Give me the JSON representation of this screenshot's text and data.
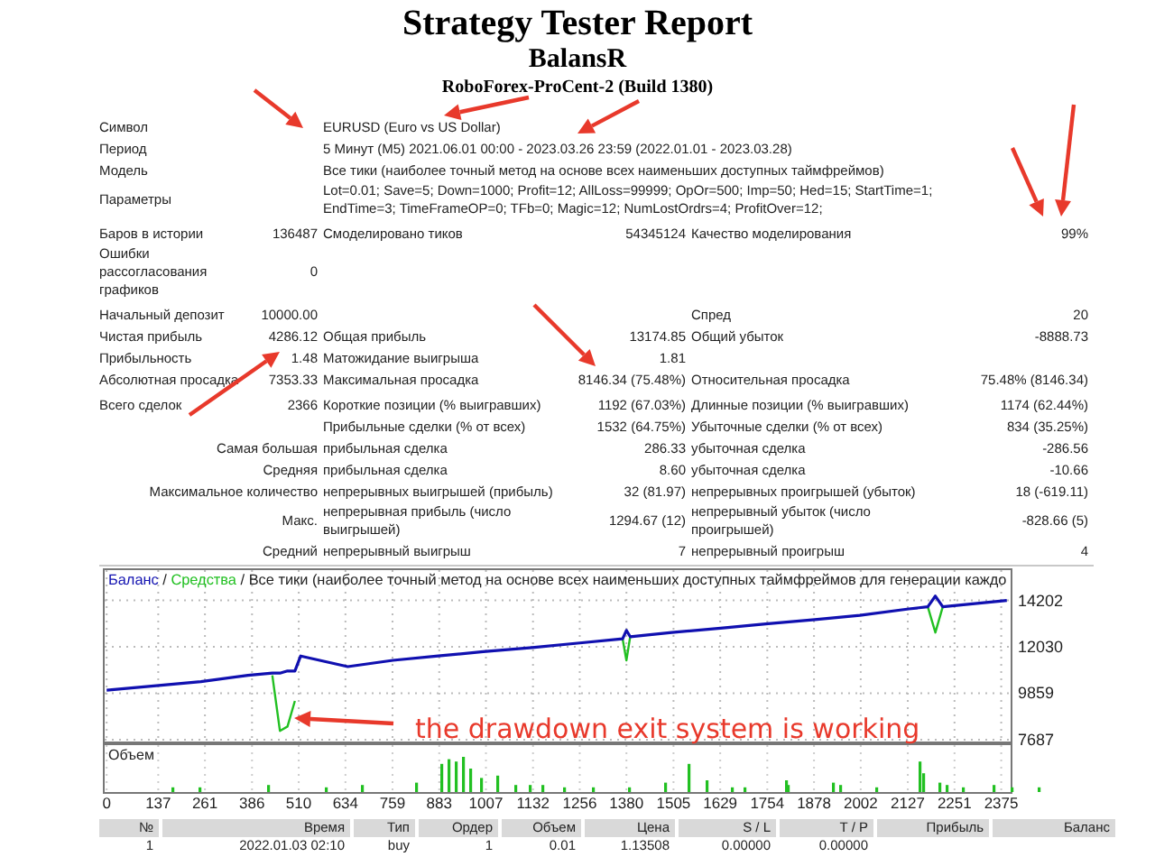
{
  "report": {
    "title": "Strategy Tester Report",
    "expert": "BalansR",
    "server": "RoboForex-ProCent-2 (Build 1380)"
  },
  "summary": {
    "sections": [
      {
        "rows": [
          {
            "kind": "wide",
            "cells": [
              "Символ",
              "EURUSD (Euro vs US Dollar)"
            ]
          },
          {
            "kind": "wide",
            "cells": [
              "Период",
              "5 Минут (M5) 2021.06.01 00:00 - 2023.03.26 23:59 (2022.01.01 - 2023.03.28)"
            ]
          },
          {
            "kind": "wide",
            "cells": [
              "Модель",
              "Все тики (наиболее точный метод на основе всех наименьших доступных таймфреймов)"
            ]
          },
          {
            "kind": "wide",
            "cells": [
              "Параметры",
              "Lot=0.01; Save=5; Down=1000; Profit=12; AllLoss=99999; OpOr=500; Imp=50; Hed=15; StartTime=1; EndTime=3; TimeFrameOP=0; TFb=0; Magic=12; NumLostOrdrs=4; ProfitOver=12;"
            ]
          }
        ]
      },
      {
        "rows": [
          {
            "kind": "grid",
            "cells": [
              "Баров в истории",
              "136487",
              "Смоделировано тиков",
              "54345124",
              "Качество моделирования",
              "99%"
            ]
          },
          {
            "kind": "grid",
            "cells": [
              "Ошибки рассогласования графиков",
              "0",
              "",
              "",
              "",
              ""
            ]
          }
        ]
      },
      {
        "rows": [
          {
            "kind": "grid",
            "cells": [
              "Начальный депозит",
              "10000.00",
              "",
              "",
              "Спред",
              "20"
            ]
          },
          {
            "kind": "grid",
            "cells": [
              "Чистая прибыль",
              "4286.12",
              "Общая прибыль",
              "13174.85",
              "Общий убыток",
              "-8888.73"
            ]
          },
          {
            "kind": "grid",
            "cells": [
              "Прибыльность",
              "1.48",
              "Матожидание выигрыша",
              "1.81",
              "",
              ""
            ]
          },
          {
            "kind": "grid",
            "cells": [
              "Абсолютная просадка",
              "7353.33",
              "Максимальная просадка",
              "8146.34 (75.48%)",
              "Относительная просадка",
              "75.48% (8146.34)"
            ]
          }
        ]
      },
      {
        "rows": [
          {
            "kind": "grid",
            "cells": [
              "Всего сделок",
              "2366",
              "Короткие позиции (% выигравших)",
              "1192 (67.03%)",
              "Длинные позиции (% выигравших)",
              "1174 (62.44%)"
            ]
          },
          {
            "kind": "grid",
            "cells": [
              "",
              "",
              "Прибыльные сделки (% от всех)",
              "1532 (64.75%)",
              "Убыточные сделки (% от всех)",
              "834 (35.25%)"
            ]
          },
          {
            "kind": "group",
            "cells": [
              "",
              "Самая большая",
              "прибыльная сделка",
              "286.33",
              "убыточная сделка",
              "-286.56"
            ]
          },
          {
            "kind": "group",
            "cells": [
              "",
              "Средняя",
              "прибыльная сделка",
              "8.60",
              "убыточная сделка",
              "-10.66"
            ]
          },
          {
            "kind": "group",
            "cells": [
              "",
              "Максимальное количество",
              "непрерывных выигрышей (прибыль)",
              "32 (81.97)",
              "непрерывных проигрышей (убыток)",
              "18 (-619.11)"
            ]
          },
          {
            "kind": "group",
            "cells": [
              "",
              "Макс.",
              "непрерывная прибыль (число выигрышей)",
              "1294.67 (12)",
              "непрерывный убыток (число проигрышей)",
              "-828.66 (5)"
            ]
          },
          {
            "kind": "group",
            "cells": [
              "",
              "Средний",
              "непрерывный выигрыш",
              "7",
              "непрерывный проигрыш",
              "4"
            ]
          }
        ]
      }
    ]
  },
  "chart": {
    "title_separator": " / ",
    "title_rest": "Все тики (наиболее точный метод на основе всех наименьших доступных таймфреймов для генерации каждо",
    "annotation_text": "the drawdown exit system is working",
    "volume_label": "Объем",
    "chart_data": {
      "type": "line",
      "grid": true,
      "x": [
        0,
        125,
        250,
        375,
        440,
        460,
        480,
        500,
        515,
        640,
        760,
        880,
        1000,
        1130,
        1250,
        1370,
        1380,
        1390,
        1500,
        1630,
        1750,
        1880,
        2000,
        2130,
        2180,
        2200,
        2220,
        2390
      ],
      "series": [
        {
          "name": "Баланс",
          "color": "#1010b0",
          "values": [
            10000,
            10200,
            10400,
            10700,
            10800,
            10800,
            10900,
            10900,
            11600,
            11100,
            11400,
            11600,
            11800,
            12000,
            12200,
            12400,
            12800,
            12500,
            12700,
            12900,
            13100,
            13300,
            13500,
            13800,
            13900,
            14400,
            13900,
            14200
          ]
        },
        {
          "name": "Средства",
          "color": "#22c022",
          "values": [
            null,
            null,
            null,
            null,
            10700,
            8100,
            8300,
            9500,
            null,
            null,
            null,
            null,
            null,
            null,
            null,
            12400,
            11400,
            12500,
            null,
            null,
            null,
            null,
            null,
            null,
            13900,
            12700,
            13900,
            null
          ]
        }
      ],
      "xlim": [
        -10,
        2400
      ],
      "ylim": [
        7600,
        15700
      ],
      "xticks": [
        0,
        137,
        261,
        386,
        510,
        634,
        759,
        883,
        1007,
        1132,
        1256,
        1380,
        1505,
        1629,
        1754,
        1878,
        2002,
        2127,
        2251,
        2375
      ],
      "yticks": [
        7687,
        9859,
        12030,
        14202
      ]
    }
  },
  "trades": {
    "columns": [
      "№",
      "Время",
      "Тип",
      "Ордер",
      "Объем",
      "Цена",
      "S / L",
      "T / P",
      "Прибыль",
      "Баланс"
    ],
    "rows": [
      [
        "1",
        "2022.01.03 02:10",
        "buy",
        "1",
        "0.01",
        "1.13508",
        "0.00000",
        "0.00000"
      ]
    ]
  }
}
